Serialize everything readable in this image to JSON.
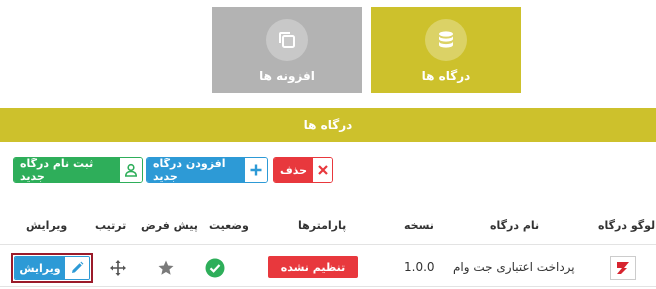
{
  "tiles": {
    "addons": {
      "label": "افزونه ها",
      "icon": "copy-icon"
    },
    "gateways": {
      "label": "درگاه ها",
      "icon": "database-icon"
    }
  },
  "banner": {
    "title": "درگاه ها"
  },
  "actions": {
    "delete": {
      "label": "حذف",
      "icon": "close-icon"
    },
    "add": {
      "label": "افزودن درگاه جدید",
      "icon": "plus-icon"
    },
    "register": {
      "label": "ثبت نام درگاه جدید",
      "icon": "user-icon"
    }
  },
  "table": {
    "headers": {
      "logo": "لوگو درگاه",
      "name": "نام درگاه",
      "version": "نسخه",
      "params": "پارامترها",
      "status": "وضعیت",
      "default": "پیش فرض",
      "order": "ترتیب",
      "edit": "ویرایش"
    },
    "rows": [
      {
        "name": "پرداخت اعتباری جت وام",
        "version": "1.0.0",
        "params": "تنظیم نشده",
        "status": "active",
        "edit": "ویرایش"
      }
    ]
  },
  "colors": {
    "olive": "#cdc12c",
    "gray": "#b3b3b3",
    "red": "#e8383d",
    "blue": "#2d9ad6",
    "green": "#2eae5a",
    "outline": "#9b1b2a"
  }
}
